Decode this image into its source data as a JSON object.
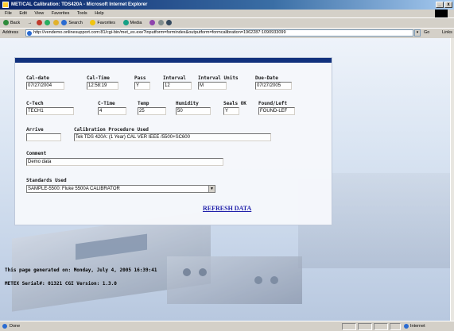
{
  "window": {
    "title": "MET/CAL Calibration: TDS420A - Microsoft Internet Explorer",
    "min": "_",
    "close": "x"
  },
  "menu": [
    "File",
    "Edit",
    "View",
    "Favorites",
    "Tools",
    "Help"
  ],
  "toolbar": {
    "back": "Back",
    "forward": "→",
    "search": "Search",
    "favorites": "Favorites",
    "media": "Media"
  },
  "address": {
    "label": "Address",
    "url": "http://vendemo.onlinesupport.com:81/cgi-bin/met_ex.exe?inputform=formindex&outputform=formcalibration=1962287:1090933099",
    "go": "Go",
    "links": "Links"
  },
  "form": {
    "labels": {
      "cal_date": "Cal-date",
      "cal_time": "Cal-Time",
      "pass": "Pass",
      "interval": "Interval",
      "interval_units": "Interval Units",
      "due_date": "Due-Date",
      "c_tech": "C-Tech",
      "c_time": "C-Time",
      "temp": "Temp",
      "humidity": "Humidity",
      "seals_ok": "Seals OK",
      "found_left": "Found/Left",
      "arrive": "Arrive",
      "procedure": "Calibration Procedure Used",
      "comment": "Comment",
      "standards": "Standards Used"
    },
    "values": {
      "cal_date": "07/27/2004",
      "cal_time": "12:58:19",
      "pass": "Y",
      "interval": "12",
      "interval_units": "M",
      "due_date": "07/27/2005",
      "c_tech": "TECH1",
      "c_time": "4",
      "temp": "25",
      "humidity": "50",
      "seals_ok": "Y",
      "found_left": "FOUND-LEF",
      "arrive": "",
      "procedure": "Tek TDS 420A: (1 Year) CAL VER IEEE /5500+SC600",
      "comment": "Demo data",
      "standards": "SAMPLE-5500: Fluke 5500A CALIBRATOR"
    },
    "refresh": "REFRESH DATA"
  },
  "footer": {
    "generated": "This page generated on: Monday, July 4, 2005 16:39:41",
    "serial": "METEX  Serial#: 01321  CGI Version: 1.3.0"
  },
  "status": {
    "text": "Done",
    "zone": "Internet"
  },
  "colors": {
    "header_bar": "#0b2b7a",
    "link": "#1a1aa8",
    "titlebar": "#0a246a"
  }
}
